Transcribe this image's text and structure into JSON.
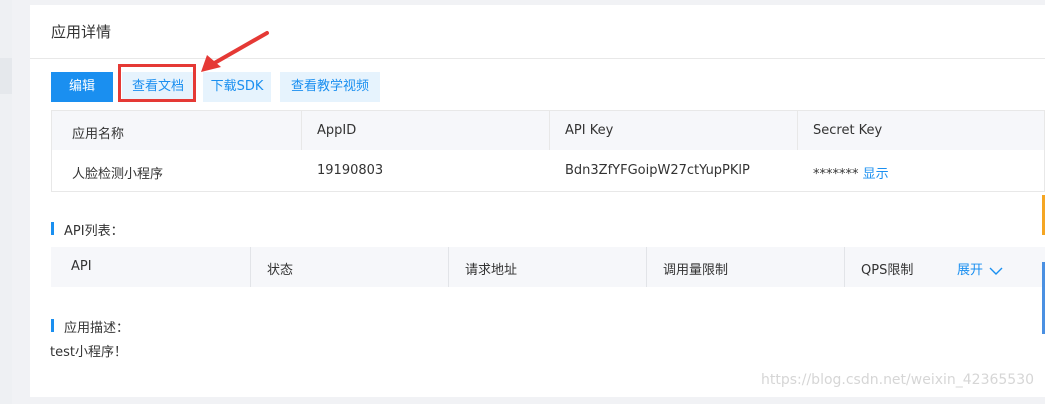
{
  "panel": {
    "title": "应用详情"
  },
  "toolbar": {
    "edit_label": "编辑",
    "docs_label": "查看文档",
    "sdk_label": "下载SDK",
    "video_label": "查看教学视频"
  },
  "info_table": {
    "headers": [
      "应用名称",
      "AppID",
      "API Key",
      "Secret Key"
    ],
    "row": {
      "app_name": "人脸检测小程序",
      "app_id": "19190803",
      "api_key": "Bdn3ZfYFGoipW27ctYupPKlP",
      "secret_masked": "*******",
      "show_label": "显示"
    }
  },
  "api_list": {
    "label": "API列表：",
    "headers": [
      "API",
      "状态",
      "请求地址",
      "调用量限制",
      "QPS限制"
    ],
    "expand_label": "展开"
  },
  "description": {
    "label": "应用描述：",
    "text": "test小程序！"
  },
  "watermark": "https://blog.csdn.net/weixin_42365530",
  "colors": {
    "primary": "#1a8ff0",
    "highlight": "#e53935",
    "light_button": "#e6f3fd"
  },
  "icons": [
    "chevron-down-icon",
    "annotation-arrow-icon"
  ]
}
